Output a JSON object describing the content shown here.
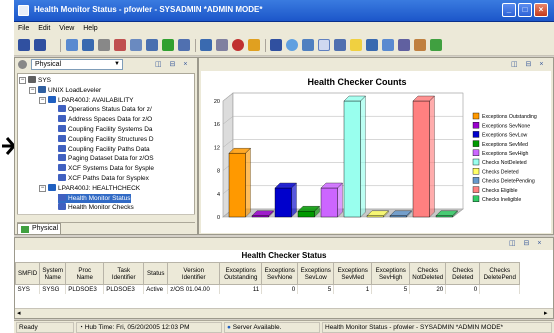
{
  "window": {
    "title": "Health Monitor Status - pfowler - SYSADMIN   *ADMIN MODE*",
    "controls": [
      "_",
      "□",
      "×"
    ]
  },
  "menu": [
    "File",
    "Edit",
    "View",
    "Help"
  ],
  "toolbar": {
    "icons": [
      "back-icon",
      "forward-icon",
      "open-icon",
      "save-icon",
      "properties-icon",
      "workspace-icon",
      "link-icon",
      "help-icon",
      "refresh-icon",
      "find-icon",
      "stop-icon",
      "alert-icon",
      "chart-icon",
      "grid-icon",
      "plot-icon",
      "table-icon",
      "notepad-icon"
    ]
  },
  "navigator": {
    "perspective": "Physical",
    "tab_label": "Physical",
    "tree": [
      {
        "label": "SYS",
        "level": 0,
        "expanded": true
      },
      {
        "label": "UNIX LoadLeveler",
        "level": 1,
        "expanded": true
      },
      {
        "label": "LPAR400J: AVAILABILITY",
        "level": 2,
        "expanded": true
      },
      {
        "label": "Operations Status Data for z/",
        "level": 3
      },
      {
        "label": "Address Spaces Data for z/O",
        "level": 3
      },
      {
        "label": "Coupling Facility Systems Da",
        "level": 3
      },
      {
        "label": "Coupling Facility Structures D",
        "level": 3
      },
      {
        "label": "Coupling Facility Paths Data",
        "level": 3
      },
      {
        "label": "Paging Dataset Data for z/OS",
        "level": 3
      },
      {
        "label": "XCF Systems Data for Sysple",
        "level": 3
      },
      {
        "label": "XCF Paths Data for Sysplex",
        "level": 3
      },
      {
        "label": "LPAR400J: HEALTHCHECK",
        "level": 2,
        "expanded": true
      },
      {
        "label": "Health Monitor Status",
        "level": 3,
        "selected": true
      },
      {
        "label": "Health Monitor Checks",
        "level": 3
      }
    ]
  },
  "chart_data": {
    "type": "bar",
    "title": "Health Checker Counts",
    "ylim": [
      0,
      20
    ],
    "yticks": [
      "0",
      "4",
      "8",
      "12",
      "16",
      "20"
    ],
    "grid": true,
    "legend_position": "right",
    "series": [
      {
        "name": "Exceptions Outstanding",
        "color": "#ff9900",
        "value": 11
      },
      {
        "name": "Exceptions SevNone",
        "color": "#9900cc",
        "value": 0
      },
      {
        "name": "Exceptions SevLow",
        "color": "#0000cc",
        "value": 5
      },
      {
        "name": "Exceptions SevMed",
        "color": "#009900",
        "value": 1
      },
      {
        "name": "Exceptions SevHigh",
        "color": "#cc66ff",
        "value": 5
      },
      {
        "name": "Checks NotDeleted",
        "color": "#99ffee",
        "value": 20
      },
      {
        "name": "Checks Deleted",
        "color": "#ffff66",
        "value": 0
      },
      {
        "name": "Checks DeletePending",
        "color": "#6699cc",
        "value": 0
      },
      {
        "name": "Checks Eligible",
        "color": "#ff8080",
        "value": 20
      },
      {
        "name": "Checks Ineligible",
        "color": "#33cc66",
        "value": 0
      }
    ]
  },
  "status_table": {
    "title": "Health Checker Status",
    "columns": [
      "SMFID",
      "System Name",
      "Proc Name",
      "Task Identifier",
      "Status",
      "Version Identifier",
      "Exceptions Outstanding",
      "Exceptions SevNone",
      "Exceptions SevLow",
      "Exceptions SevMed",
      "Exceptions SevHigh",
      "Checks NotDeleted",
      "Checks Deleted",
      "Checks DeletePend"
    ],
    "rows": [
      [
        "SYS",
        "SYSG",
        "PLDSOE3",
        "PLDSOE3",
        "Active",
        "z/OS 01.04.00",
        "11",
        "0",
        "5",
        "1",
        "5",
        "20",
        "0",
        ""
      ]
    ]
  },
  "statusbar": {
    "ready": "Ready",
    "hub_time": "Hub Time: Fri, 05/20/2005 12:03 PM",
    "server": "Server Available.",
    "workspace": "Health Monitor Status - pfowler - SYSADMIN   *ADMIN MODE*"
  },
  "panel_buttons": "◫ ⊟ ×"
}
